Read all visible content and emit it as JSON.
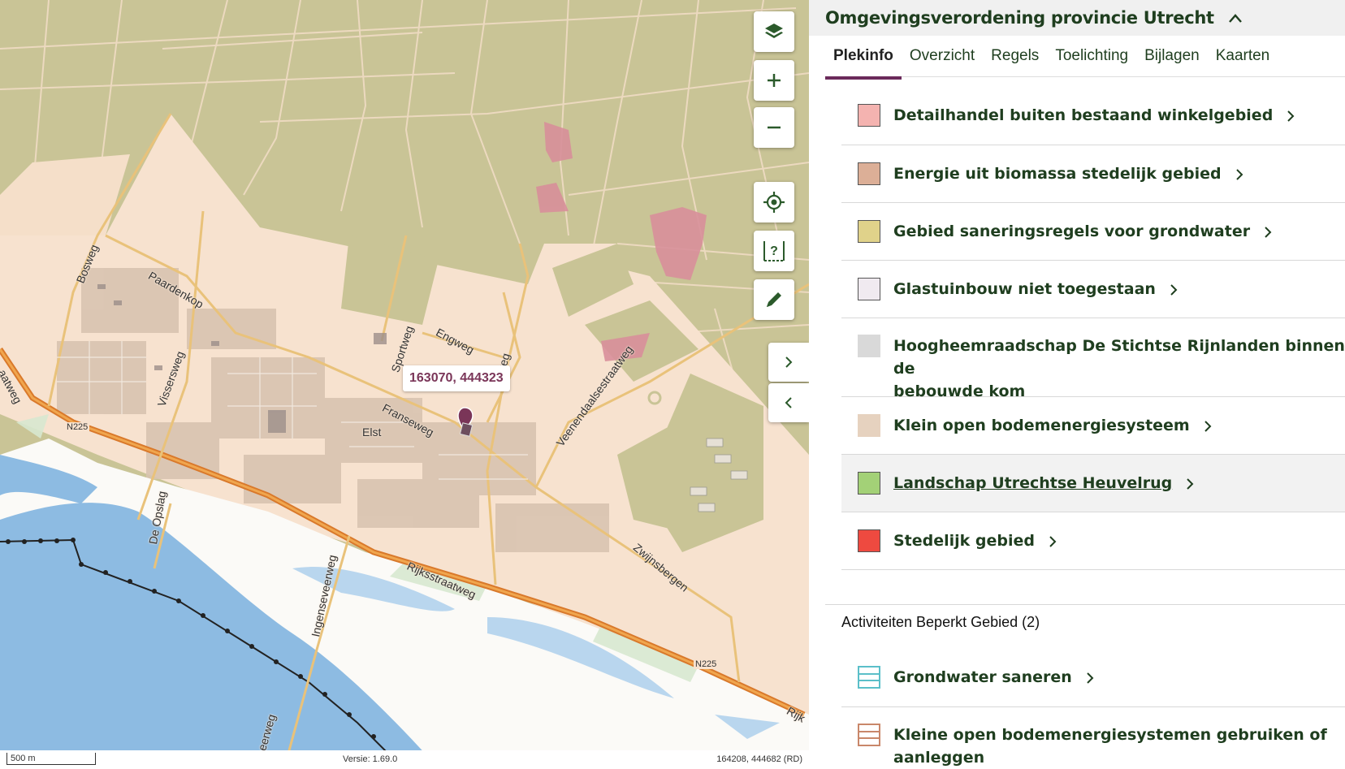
{
  "map": {
    "labels": {
      "bosweg": "Bosweg",
      "paardenkop": "Paardenkop",
      "vissersweg": "Vissersweg",
      "sportweg": "Sportweg",
      "engweg": "Engweg",
      "weg_partial": "weg",
      "franseweg": "Franseweg",
      "elst": "Elst",
      "veenendaalsestraatweg": "Veenendaalsestraatweg",
      "de_opslag": "De Opslag",
      "ingenseveerweg": "Ingenseveerweg",
      "rijksstraatweg": "Rijksstraatweg",
      "zwijnsbergen": "Zwijnsbergen",
      "aatweg": "aatweg",
      "eerweg": "eerweg",
      "rijk": "Rijk",
      "n225_left": "N225",
      "n225_right": "N225"
    },
    "coordinate_popup": "163070, 444323",
    "status": {
      "scale": "500 m",
      "version": "Versie: 1.69.0",
      "cursor_coords": "164208, 444682 (RD)"
    },
    "icons": {
      "layers": "layers-icon",
      "zoom_in": "plus-icon",
      "zoom_out": "minus-icon",
      "locate": "crosshair-icon",
      "info": "info-query-icon",
      "draw": "pencil-icon",
      "expand": "chevron-right-icon",
      "collapse": "chevron-left-icon"
    }
  },
  "panel": {
    "title": "Omgevingsverordening provincie Utrecht",
    "tabs": [
      {
        "label": "Plekinfo",
        "active": true
      },
      {
        "label": "Overzicht",
        "active": false
      },
      {
        "label": "Regels",
        "active": false
      },
      {
        "label": "Toelichting",
        "active": false
      },
      {
        "label": "Bijlagen",
        "active": false
      },
      {
        "label": "Kaarten",
        "active": false
      }
    ],
    "items": [
      {
        "label": "Detailhandel buiten bestaand winkelgebied",
        "color": "#f4b3b0"
      },
      {
        "label": "Energie uit biomassa stedelijk gebied",
        "color": "#dcaf97"
      },
      {
        "label": "Gebied saneringsregels voor grondwater",
        "color": "#e0d28a"
      },
      {
        "label": "Glastuinbouw niet toegestaan",
        "color": "#f0eaf0"
      },
      {
        "label": "Hoogheemraadschap De Stichtse Rijnlanden binnen de",
        "label2": "bebouwde kom",
        "color": "#d9d9d9"
      },
      {
        "label": "Klein open bodemenergiesysteem",
        "color": "#e6d2bf"
      },
      {
        "label": "Landschap Utrechtse Heuvelrug",
        "color": "#a3d177",
        "highlighted": true
      },
      {
        "label": "Stedelijk gebied",
        "color": "#ee4a40"
      }
    ],
    "section2_title": "Activiteiten Beperkt Gebied (2)",
    "activities": [
      {
        "label": "Grondwater saneren",
        "color": "#5bbfc9"
      },
      {
        "label": "Kleine open bodemenergiesystemen gebruiken of",
        "label2": "aanleggen",
        "color": "#c9876a"
      }
    ]
  }
}
